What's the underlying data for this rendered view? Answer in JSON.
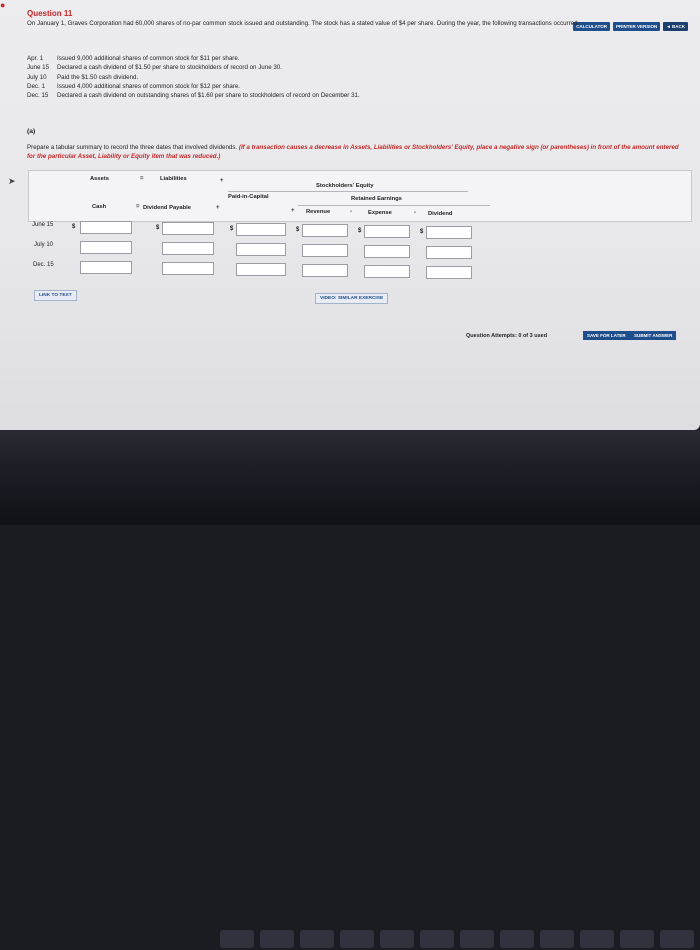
{
  "question": {
    "title": "Question 11"
  },
  "toolbar": {
    "calculator": "CALCULATOR",
    "printer_version": "PRINTER VERSION",
    "back": "◄ BACK"
  },
  "intro": "On January 1, Graves Corporation had 60,000 shares of no-par common stock issued and outstanding. The stock has a stated value of $4 per share. During the year, the following transactions occurred.",
  "transactions": [
    {
      "date": "Apr. 1",
      "text": "Issued 9,000 additional shares of common stock for $11 per share."
    },
    {
      "date": "June 15",
      "text": "Declared a cash dividend of $1.50 per share to stockholders of record on June 30."
    },
    {
      "date": "July 10",
      "text": "Paid the $1.50 cash dividend."
    },
    {
      "date": "Dec. 1",
      "text": "Issued 4,000 additional shares of common stock for $12 per share."
    },
    {
      "date": "Dec. 15",
      "text": "Declared a cash dividend on outstanding shares of $1.60 per share to stockholders of record on December 31."
    }
  ],
  "part": "(a)",
  "instructions": {
    "plain": "Prepare a tabular summary to record the three dates that involved dividends.",
    "red": "(If a transaction causes a decrease in Assets, Liabilities or Stockholders' Equity, place a negative sign (or parentheses) in front of the amount entered for the particular Asset, Liability or Equity item that was reduced.)"
  },
  "table": {
    "assets": "Assets",
    "eq": "=",
    "liabilities": "Liabilities",
    "plus": "+",
    "minus": "-",
    "stockholders_equity": "Stockholders' Equity",
    "paid_in_capital": "Paid-in-Capital",
    "retained_earnings": "Retained Earnings",
    "cash": "Cash",
    "dividend_payable": "Dividend Payable",
    "revenue": "Revenue",
    "expense": "Expense",
    "dividend": "Dividend",
    "dollar": "$",
    "rows": [
      "June 15",
      "July 10",
      "Dec. 15"
    ]
  },
  "links": {
    "link_to_text": "LINK TO TEXT",
    "video": "VIDEO: SIMILAR EXERCISE"
  },
  "footer": {
    "attempts": "Question Attempts: 0 of 3 used",
    "save": "SAVE FOR LATER",
    "submit": "SUBMIT ANSWER"
  }
}
